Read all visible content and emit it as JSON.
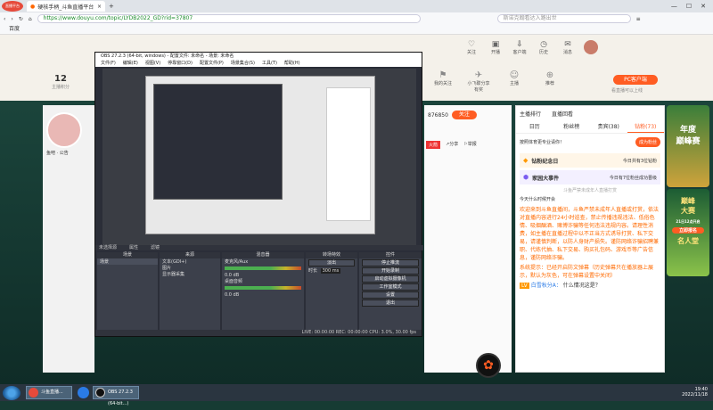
{
  "browser": {
    "tab_title": "硬核手柄_斗鱼直播平台",
    "url": "https://www.douyu.com/topic/LYDB2022_GD?rid=37807",
    "search_placeholder": "斯诺克翰看达入路出世",
    "bookmark": "百度",
    "logo_text": "直播平台"
  },
  "site": {
    "follower_count": "12",
    "follower_label": "主播积分",
    "nav": [
      {
        "label": "我的关注",
        "icon": "follow-icon"
      },
      {
        "label": "小飞碟分享有奖",
        "icon": "ufo-icon"
      },
      {
        "label": "主播",
        "icon": "streamer-icon"
      },
      {
        "label": "推荐",
        "icon": "recommend-icon"
      }
    ],
    "user_menu": [
      "关注",
      "开播",
      "客户端",
      "历史",
      "消息"
    ],
    "pc_client": "PC客户端",
    "pc_client_sub": "看直播可以上线",
    "follow_count": "876850",
    "follow_btn": "关注",
    "share": "分享",
    "report": "举报",
    "fire": "火箭",
    "streamer_name": "鱼吧 · 公告"
  },
  "obs": {
    "title": "OBS 27.2.3 (64-bit, windows) - 配置文件: 未命名 - 场景: 未命名",
    "menu": [
      "文件(F)",
      "编辑(E)",
      "视图(V)",
      "停靠窗口(D)",
      "配置文件(P)",
      "场景集合(S)",
      "工具(T)",
      "帮助(H)"
    ],
    "status_label": "未选择源",
    "properties": "属性",
    "filters": "滤镜",
    "docks": {
      "scenes": {
        "title": "场景",
        "items": [
          "场景"
        ]
      },
      "sources": {
        "title": "来源",
        "items": [
          "文本(GDI+)",
          "图片",
          "显示器采集"
        ]
      },
      "mixer": {
        "title": "混音器",
        "channels": [
          "麦克风/Aux",
          "桌面音频"
        ],
        "db": "0.0 dB"
      },
      "transitions": {
        "title": "转场特效",
        "type": "淡出",
        "duration_label": "时长",
        "duration": "300 ms"
      },
      "controls": {
        "title": "控件",
        "buttons": [
          "停止推流",
          "开始录制",
          "启动虚拟摄像机",
          "工作室模式",
          "设置",
          "退出"
        ]
      }
    },
    "status_bar": "LIVE: 00:00:00   REC: 00:00:00   CPU: 3.0%, 30.00 fps"
  },
  "room": {
    "tabs": [
      "日历",
      "粉丝榜",
      "贵宾(38)",
      "钻粉(73)"
    ],
    "header_tabs": [
      "主播排行",
      "直播回看"
    ],
    "notice": "按照体育更专业请你！",
    "gift_btn": "成为粉丝",
    "event1": "钻粉纪念日",
    "event1_sub": "今日共有3位钻粉",
    "event2": "家园大事件",
    "event2_sub": "今日有7位粉丝成功晋级",
    "hint": "斗鱼严禁未成年人直播打赏",
    "user_join": "今天什么时候开会",
    "chat_notice": "欢迎来到斗鱼直播间，斗鱼严禁未成年人直播或打赏，依法对直播内容进行24小时巡查，禁止传播违规违法、低俗色情、吸烟酗酒、赌博诈骗等任何违法违规内容。请理性消费，如主播在直播过程中以不正当方式诱导打赏、私下交易，请谨慎判断，以防人身财产损失。谨防网络诈骗招聘兼职、代练代抽、私下交易、购买礼包码、游戏币等广告信息，谨防网络诈骗。",
    "system_msg": "系统提示：已经开启防文弹幕（历史弹幕只在播放器上展示，默认为灰色，可在弹幕设置中关闭）",
    "user_msg_name": "白雪秋分A：",
    "user_msg": "什么情况这是？",
    "level_badge": "LV",
    "ad_lines": [
      "年度",
      "巅峰赛",
      "巅峰",
      "大赛",
      "21日12点开启",
      "立即报名",
      "名人堂"
    ]
  },
  "taskbar": {
    "items": [
      "斗鱼直播...",
      "OBS 27.2.3 (64-bit...)"
    ],
    "time": "19:40",
    "date": "2022/11/18"
  }
}
